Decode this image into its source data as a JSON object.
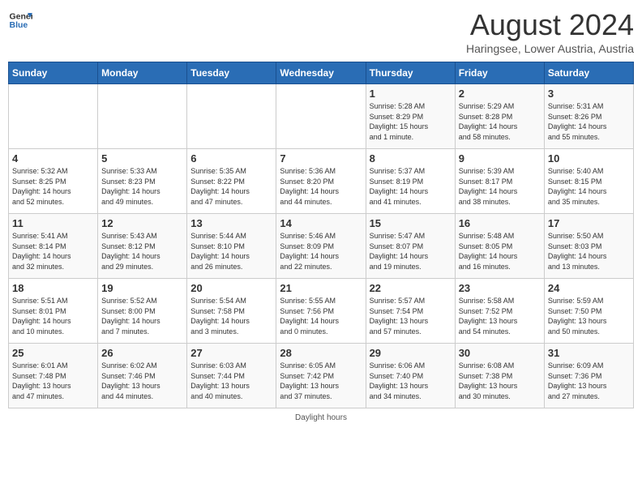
{
  "header": {
    "logo_line1": "General",
    "logo_line2": "Blue",
    "month": "August 2024",
    "location": "Haringsee, Lower Austria, Austria"
  },
  "days_of_week": [
    "Sunday",
    "Monday",
    "Tuesday",
    "Wednesday",
    "Thursday",
    "Friday",
    "Saturday"
  ],
  "weeks": [
    [
      {
        "day": "",
        "info": ""
      },
      {
        "day": "",
        "info": ""
      },
      {
        "day": "",
        "info": ""
      },
      {
        "day": "",
        "info": ""
      },
      {
        "day": "1",
        "info": "Sunrise: 5:28 AM\nSunset: 8:29 PM\nDaylight: 15 hours\nand 1 minute."
      },
      {
        "day": "2",
        "info": "Sunrise: 5:29 AM\nSunset: 8:28 PM\nDaylight: 14 hours\nand 58 minutes."
      },
      {
        "day": "3",
        "info": "Sunrise: 5:31 AM\nSunset: 8:26 PM\nDaylight: 14 hours\nand 55 minutes."
      }
    ],
    [
      {
        "day": "4",
        "info": "Sunrise: 5:32 AM\nSunset: 8:25 PM\nDaylight: 14 hours\nand 52 minutes."
      },
      {
        "day": "5",
        "info": "Sunrise: 5:33 AM\nSunset: 8:23 PM\nDaylight: 14 hours\nand 49 minutes."
      },
      {
        "day": "6",
        "info": "Sunrise: 5:35 AM\nSunset: 8:22 PM\nDaylight: 14 hours\nand 47 minutes."
      },
      {
        "day": "7",
        "info": "Sunrise: 5:36 AM\nSunset: 8:20 PM\nDaylight: 14 hours\nand 44 minutes."
      },
      {
        "day": "8",
        "info": "Sunrise: 5:37 AM\nSunset: 8:19 PM\nDaylight: 14 hours\nand 41 minutes."
      },
      {
        "day": "9",
        "info": "Sunrise: 5:39 AM\nSunset: 8:17 PM\nDaylight: 14 hours\nand 38 minutes."
      },
      {
        "day": "10",
        "info": "Sunrise: 5:40 AM\nSunset: 8:15 PM\nDaylight: 14 hours\nand 35 minutes."
      }
    ],
    [
      {
        "day": "11",
        "info": "Sunrise: 5:41 AM\nSunset: 8:14 PM\nDaylight: 14 hours\nand 32 minutes."
      },
      {
        "day": "12",
        "info": "Sunrise: 5:43 AM\nSunset: 8:12 PM\nDaylight: 14 hours\nand 29 minutes."
      },
      {
        "day": "13",
        "info": "Sunrise: 5:44 AM\nSunset: 8:10 PM\nDaylight: 14 hours\nand 26 minutes."
      },
      {
        "day": "14",
        "info": "Sunrise: 5:46 AM\nSunset: 8:09 PM\nDaylight: 14 hours\nand 22 minutes."
      },
      {
        "day": "15",
        "info": "Sunrise: 5:47 AM\nSunset: 8:07 PM\nDaylight: 14 hours\nand 19 minutes."
      },
      {
        "day": "16",
        "info": "Sunrise: 5:48 AM\nSunset: 8:05 PM\nDaylight: 14 hours\nand 16 minutes."
      },
      {
        "day": "17",
        "info": "Sunrise: 5:50 AM\nSunset: 8:03 PM\nDaylight: 14 hours\nand 13 minutes."
      }
    ],
    [
      {
        "day": "18",
        "info": "Sunrise: 5:51 AM\nSunset: 8:01 PM\nDaylight: 14 hours\nand 10 minutes."
      },
      {
        "day": "19",
        "info": "Sunrise: 5:52 AM\nSunset: 8:00 PM\nDaylight: 14 hours\nand 7 minutes."
      },
      {
        "day": "20",
        "info": "Sunrise: 5:54 AM\nSunset: 7:58 PM\nDaylight: 14 hours\nand 3 minutes."
      },
      {
        "day": "21",
        "info": "Sunrise: 5:55 AM\nSunset: 7:56 PM\nDaylight: 14 hours\nand 0 minutes."
      },
      {
        "day": "22",
        "info": "Sunrise: 5:57 AM\nSunset: 7:54 PM\nDaylight: 13 hours\nand 57 minutes."
      },
      {
        "day": "23",
        "info": "Sunrise: 5:58 AM\nSunset: 7:52 PM\nDaylight: 13 hours\nand 54 minutes."
      },
      {
        "day": "24",
        "info": "Sunrise: 5:59 AM\nSunset: 7:50 PM\nDaylight: 13 hours\nand 50 minutes."
      }
    ],
    [
      {
        "day": "25",
        "info": "Sunrise: 6:01 AM\nSunset: 7:48 PM\nDaylight: 13 hours\nand 47 minutes."
      },
      {
        "day": "26",
        "info": "Sunrise: 6:02 AM\nSunset: 7:46 PM\nDaylight: 13 hours\nand 44 minutes."
      },
      {
        "day": "27",
        "info": "Sunrise: 6:03 AM\nSunset: 7:44 PM\nDaylight: 13 hours\nand 40 minutes."
      },
      {
        "day": "28",
        "info": "Sunrise: 6:05 AM\nSunset: 7:42 PM\nDaylight: 13 hours\nand 37 minutes."
      },
      {
        "day": "29",
        "info": "Sunrise: 6:06 AM\nSunset: 7:40 PM\nDaylight: 13 hours\nand 34 minutes."
      },
      {
        "day": "30",
        "info": "Sunrise: 6:08 AM\nSunset: 7:38 PM\nDaylight: 13 hours\nand 30 minutes."
      },
      {
        "day": "31",
        "info": "Sunrise: 6:09 AM\nSunset: 7:36 PM\nDaylight: 13 hours\nand 27 minutes."
      }
    ]
  ],
  "footer_note": "Daylight hours"
}
